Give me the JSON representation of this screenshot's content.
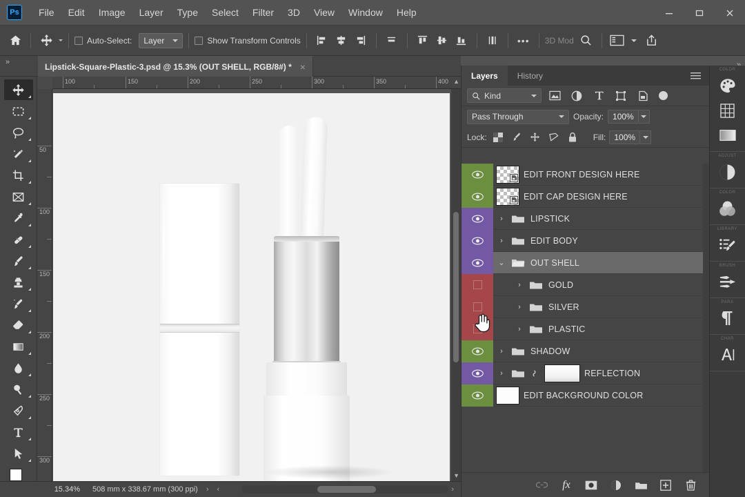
{
  "app": {
    "name": "Adobe Photoshop",
    "logo_text": "Ps"
  },
  "menubar": {
    "items": [
      {
        "label": "File"
      },
      {
        "label": "Edit"
      },
      {
        "label": "Image"
      },
      {
        "label": "Layer"
      },
      {
        "label": "Type"
      },
      {
        "label": "Select"
      },
      {
        "label": "Filter"
      },
      {
        "label": "3D"
      },
      {
        "label": "View"
      },
      {
        "label": "Window"
      },
      {
        "label": "Help"
      }
    ],
    "window_controls": [
      "minimize",
      "maximize",
      "close"
    ]
  },
  "options_bar": {
    "home_icon": "home-icon",
    "tool_icon": "move-tool-icon",
    "auto_select_label": "Auto-Select:",
    "auto_select_checked": false,
    "auto_select_target": "Layer",
    "show_transform_label": "Show Transform Controls",
    "show_transform_checked": false,
    "align_icons": [
      "align-left-edges",
      "align-horizontal-centers",
      "align-right-edges",
      "distribute-horizontally"
    ],
    "align_icons_2": [
      "align-top-edges",
      "align-vertical-centers",
      "align-bottom-edges",
      "distribute-vertically"
    ],
    "more_label": "•••",
    "mode_3d_label": "3D Mod",
    "search_icon": "search-icon",
    "workspace_icon": "workspace-switcher-icon",
    "share_icon": "share-icon"
  },
  "document": {
    "tab_title": "Lipstick-Square-Plastic-3.psd @ 15.3% (OUT SHELL, RGB/8#) *",
    "close_glyph": "×",
    "collapse_glyph": "»"
  },
  "toolbar": {
    "tools": [
      {
        "name": "move-tool",
        "active": true
      },
      {
        "name": "rectangular-marquee-tool",
        "active": false
      },
      {
        "name": "lasso-tool",
        "active": false
      },
      {
        "name": "object-selection-tool",
        "active": false
      },
      {
        "name": "crop-tool",
        "active": false
      },
      {
        "name": "frame-tool",
        "active": false
      },
      {
        "name": "eyedropper-tool",
        "active": false
      },
      {
        "name": "spot-healing-brush-tool",
        "active": false
      },
      {
        "name": "brush-tool",
        "active": false
      },
      {
        "name": "clone-stamp-tool",
        "active": false
      },
      {
        "name": "history-brush-tool",
        "active": false
      },
      {
        "name": "eraser-tool",
        "active": false
      },
      {
        "name": "gradient-tool",
        "active": false
      },
      {
        "name": "blur-tool",
        "active": false
      },
      {
        "name": "dodge-tool",
        "active": false
      },
      {
        "name": "pen-tool",
        "active": false
      },
      {
        "name": "horizontal-type-tool",
        "active": false
      },
      {
        "name": "path-selection-tool",
        "active": false
      }
    ],
    "foreground_color": "#ffffff",
    "background_color": "#ffffff"
  },
  "rulers": {
    "horizontal_ticks": [
      "100",
      "150",
      "200",
      "250",
      "300",
      "350",
      "400"
    ],
    "vertical_ticks": [
      "50",
      "100",
      "150",
      "200",
      "250",
      "300"
    ],
    "unit": "mm"
  },
  "status_bar": {
    "zoom": "15.34%",
    "doc_size": "508 mm x 338.67 mm (300 ppi)",
    "arrow_glyph": "›",
    "left_arrow_glyph": "‹"
  },
  "layers_panel": {
    "tabs": [
      {
        "label": "Layers",
        "active": true
      },
      {
        "label": "History",
        "active": false
      }
    ],
    "menu_icon": "panel-menu-icon",
    "filter": {
      "search_icon": "search-icon",
      "kind_label": "Kind",
      "icons": [
        "filter-pixel-icon",
        "filter-adjustment-icon",
        "filter-type-icon",
        "filter-shape-icon",
        "filter-smart-object-icon"
      ],
      "toggle_name": "filter-enable-toggle"
    },
    "blend_mode": "Pass Through",
    "opacity_label": "Opacity:",
    "opacity_value": "100%",
    "lock_label": "Lock:",
    "lock_icons": [
      "lock-transparent-pixels",
      "lock-image-pixels",
      "lock-position",
      "lock-artboard-nesting",
      "lock-all"
    ],
    "fill_label": "Fill:",
    "fill_value": "100%",
    "layers": [
      {
        "name": "EDIT FRONT DESIGN HERE",
        "visible": true,
        "eye_color": "green",
        "thumb": "smart-object",
        "indent": 0,
        "expandable": false,
        "selected": false
      },
      {
        "name": "EDIT CAP DESIGN HERE",
        "visible": true,
        "eye_color": "green",
        "thumb": "smart-object",
        "indent": 0,
        "expandable": false,
        "selected": false
      },
      {
        "name": "LIPSTICK",
        "visible": true,
        "eye_color": "purple",
        "thumb": "folder",
        "indent": 0,
        "expandable": true,
        "expanded": false,
        "selected": false
      },
      {
        "name": "EDIT BODY",
        "visible": true,
        "eye_color": "purple",
        "thumb": "folder",
        "indent": 0,
        "expandable": true,
        "expanded": false,
        "selected": false
      },
      {
        "name": "OUT SHELL",
        "visible": true,
        "eye_color": "purple",
        "thumb": "folder-open",
        "indent": 0,
        "expandable": true,
        "expanded": true,
        "selected": true
      },
      {
        "name": "GOLD",
        "visible": false,
        "eye_color": "red",
        "thumb": "folder",
        "indent": 1,
        "expandable": true,
        "expanded": false,
        "selected": false
      },
      {
        "name": "SILVER",
        "visible": false,
        "eye_color": "red",
        "thumb": "folder",
        "indent": 1,
        "expandable": true,
        "expanded": false,
        "selected": false
      },
      {
        "name": "PLASTIC",
        "visible": false,
        "eye_color": "red",
        "thumb": "folder",
        "indent": 1,
        "expandable": true,
        "expanded": false,
        "selected": false
      },
      {
        "name": "SHADOW",
        "visible": true,
        "eye_color": "green",
        "thumb": "folder",
        "indent": 0,
        "expandable": true,
        "expanded": false,
        "selected": false
      },
      {
        "name": "REFLECTION",
        "visible": true,
        "eye_color": "purple",
        "thumb": "folder-mask",
        "indent": 0,
        "expandable": true,
        "expanded": false,
        "selected": false
      },
      {
        "name": "EDIT BACKGROUND COLOR",
        "visible": true,
        "eye_color": "green",
        "thumb": "solid-white",
        "indent": 0,
        "expandable": false,
        "selected": false
      }
    ],
    "footer_buttons": [
      {
        "name": "link-layers-button",
        "glyph": "link"
      },
      {
        "name": "layer-style-button",
        "glyph": "fx"
      },
      {
        "name": "add-layer-mask-button",
        "glyph": "mask"
      },
      {
        "name": "new-adjustment-layer-button",
        "glyph": "adjustment"
      },
      {
        "name": "new-group-button",
        "glyph": "folder"
      },
      {
        "name": "new-layer-button",
        "glyph": "plus"
      },
      {
        "name": "delete-layer-button",
        "glyph": "trash"
      }
    ]
  },
  "right_dock": {
    "groups": [
      {
        "label": "COLOR",
        "icons": [
          "color-palette-icon",
          "swatches-icon",
          "gradients-icon"
        ]
      },
      {
        "label": "ADJUST",
        "icons": [
          "adjustments-icon"
        ]
      },
      {
        "label": "COLOR",
        "icons": [
          "color-mixer-icon"
        ]
      },
      {
        "label": "LIBRARY",
        "icons": [
          "libraries-icon"
        ]
      },
      {
        "label": "BRUSH",
        "icons": [
          "brush-settings-icon"
        ]
      },
      {
        "label": "PARA",
        "icons": [
          "paragraph-icon"
        ]
      },
      {
        "label": "CHAR",
        "icons": [
          "character-icon"
        ]
      }
    ]
  },
  "canvas": {
    "background_color": "#f1f1f1",
    "artwork_description": "lipstick-mockup",
    "cursor": "hand-cursor"
  },
  "colors": {
    "chrome": "#535353",
    "panel": "#454545",
    "selected_row": "#6a6a6a",
    "eye_green": "#6b8f3e",
    "eye_purple": "#7359a4",
    "eye_red": "#a5474a",
    "accent": "#31a8ff"
  }
}
